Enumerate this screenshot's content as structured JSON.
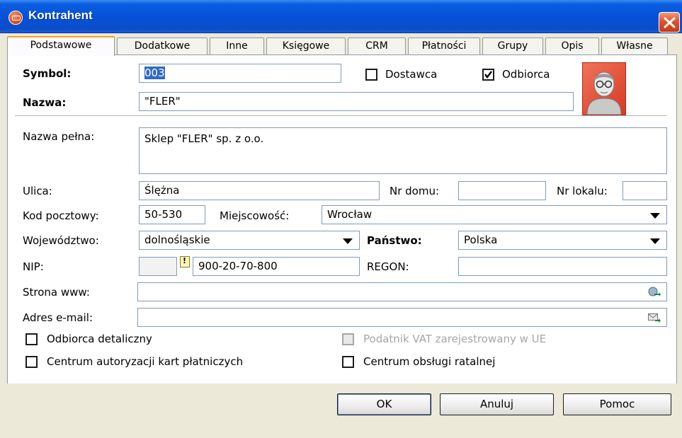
{
  "window": {
    "title": "Kontrahent"
  },
  "tabs": [
    "Podstawowe",
    "Dodatkowe",
    "Inne",
    "Księgowe",
    "CRM",
    "Płatności",
    "Grupy",
    "Opis",
    "Własne"
  ],
  "form": {
    "symbol": {
      "label": "Symbol:",
      "value": "003"
    },
    "dostawca": {
      "label": "Dostawca",
      "checked": false
    },
    "odbiorca": {
      "label": "Odbiorca",
      "checked": true
    },
    "nazwa": {
      "label": "Nazwa:",
      "value": "\"FLER\""
    },
    "nazwa_pelna": {
      "label": "Nazwa pełna:",
      "value": "Sklep \"FLER\" sp. z o.o."
    },
    "ulica": {
      "label": "Ulica:",
      "value": "Ślężna"
    },
    "nr_domu": {
      "label": "Nr domu:",
      "value": ""
    },
    "nr_lokalu": {
      "label": "Nr lokalu:",
      "value": ""
    },
    "kod_pocztowy": {
      "label": "Kod pocztowy:",
      "value": "50-530"
    },
    "miejscowosc": {
      "label": "Miejscowość:",
      "value": "Wrocław"
    },
    "wojewodztwo": {
      "label": "Województwo:",
      "value": "dolnośląskie"
    },
    "panstwo": {
      "label": "Państwo:",
      "value": "Polska"
    },
    "nip": {
      "label": "NIP:",
      "prefix": "",
      "value": "900-20-70-800"
    },
    "regon": {
      "label": "REGON:",
      "value": ""
    },
    "strona_www": {
      "label": "Strona www:",
      "value": ""
    },
    "adres_email": {
      "label": "Adres e-mail:",
      "value": ""
    },
    "odbiorca_detaliczny": {
      "label": "Odbiorca detaliczny",
      "checked": false
    },
    "podatnik_vat_ue": {
      "label": "Podatnik VAT zarejestrowany w UE",
      "checked": false,
      "disabled": true
    },
    "centrum_autoryzacji": {
      "label": "Centrum autoryzacji kart płatniczych",
      "checked": false
    },
    "centrum_obslugi": {
      "label": "Centrum obsługi ratalnej",
      "checked": false
    }
  },
  "buttons": {
    "ok": "OK",
    "anuluj": "Anuluj",
    "pomoc": "Pomoc"
  },
  "icons": {
    "app": "kontrahent-app-icon",
    "close": "close-icon",
    "avatar": "person-avatar-icon",
    "web": "globe-arrow-icon",
    "mail": "envelope-arrow-icon",
    "note": "note-icon"
  },
  "colors": {
    "titlebar": "#0550d6",
    "close": "#e0532c",
    "avatar_bg": "#e0502e",
    "selection": "#316ac5",
    "tab_highlight": "#f7a21b"
  }
}
